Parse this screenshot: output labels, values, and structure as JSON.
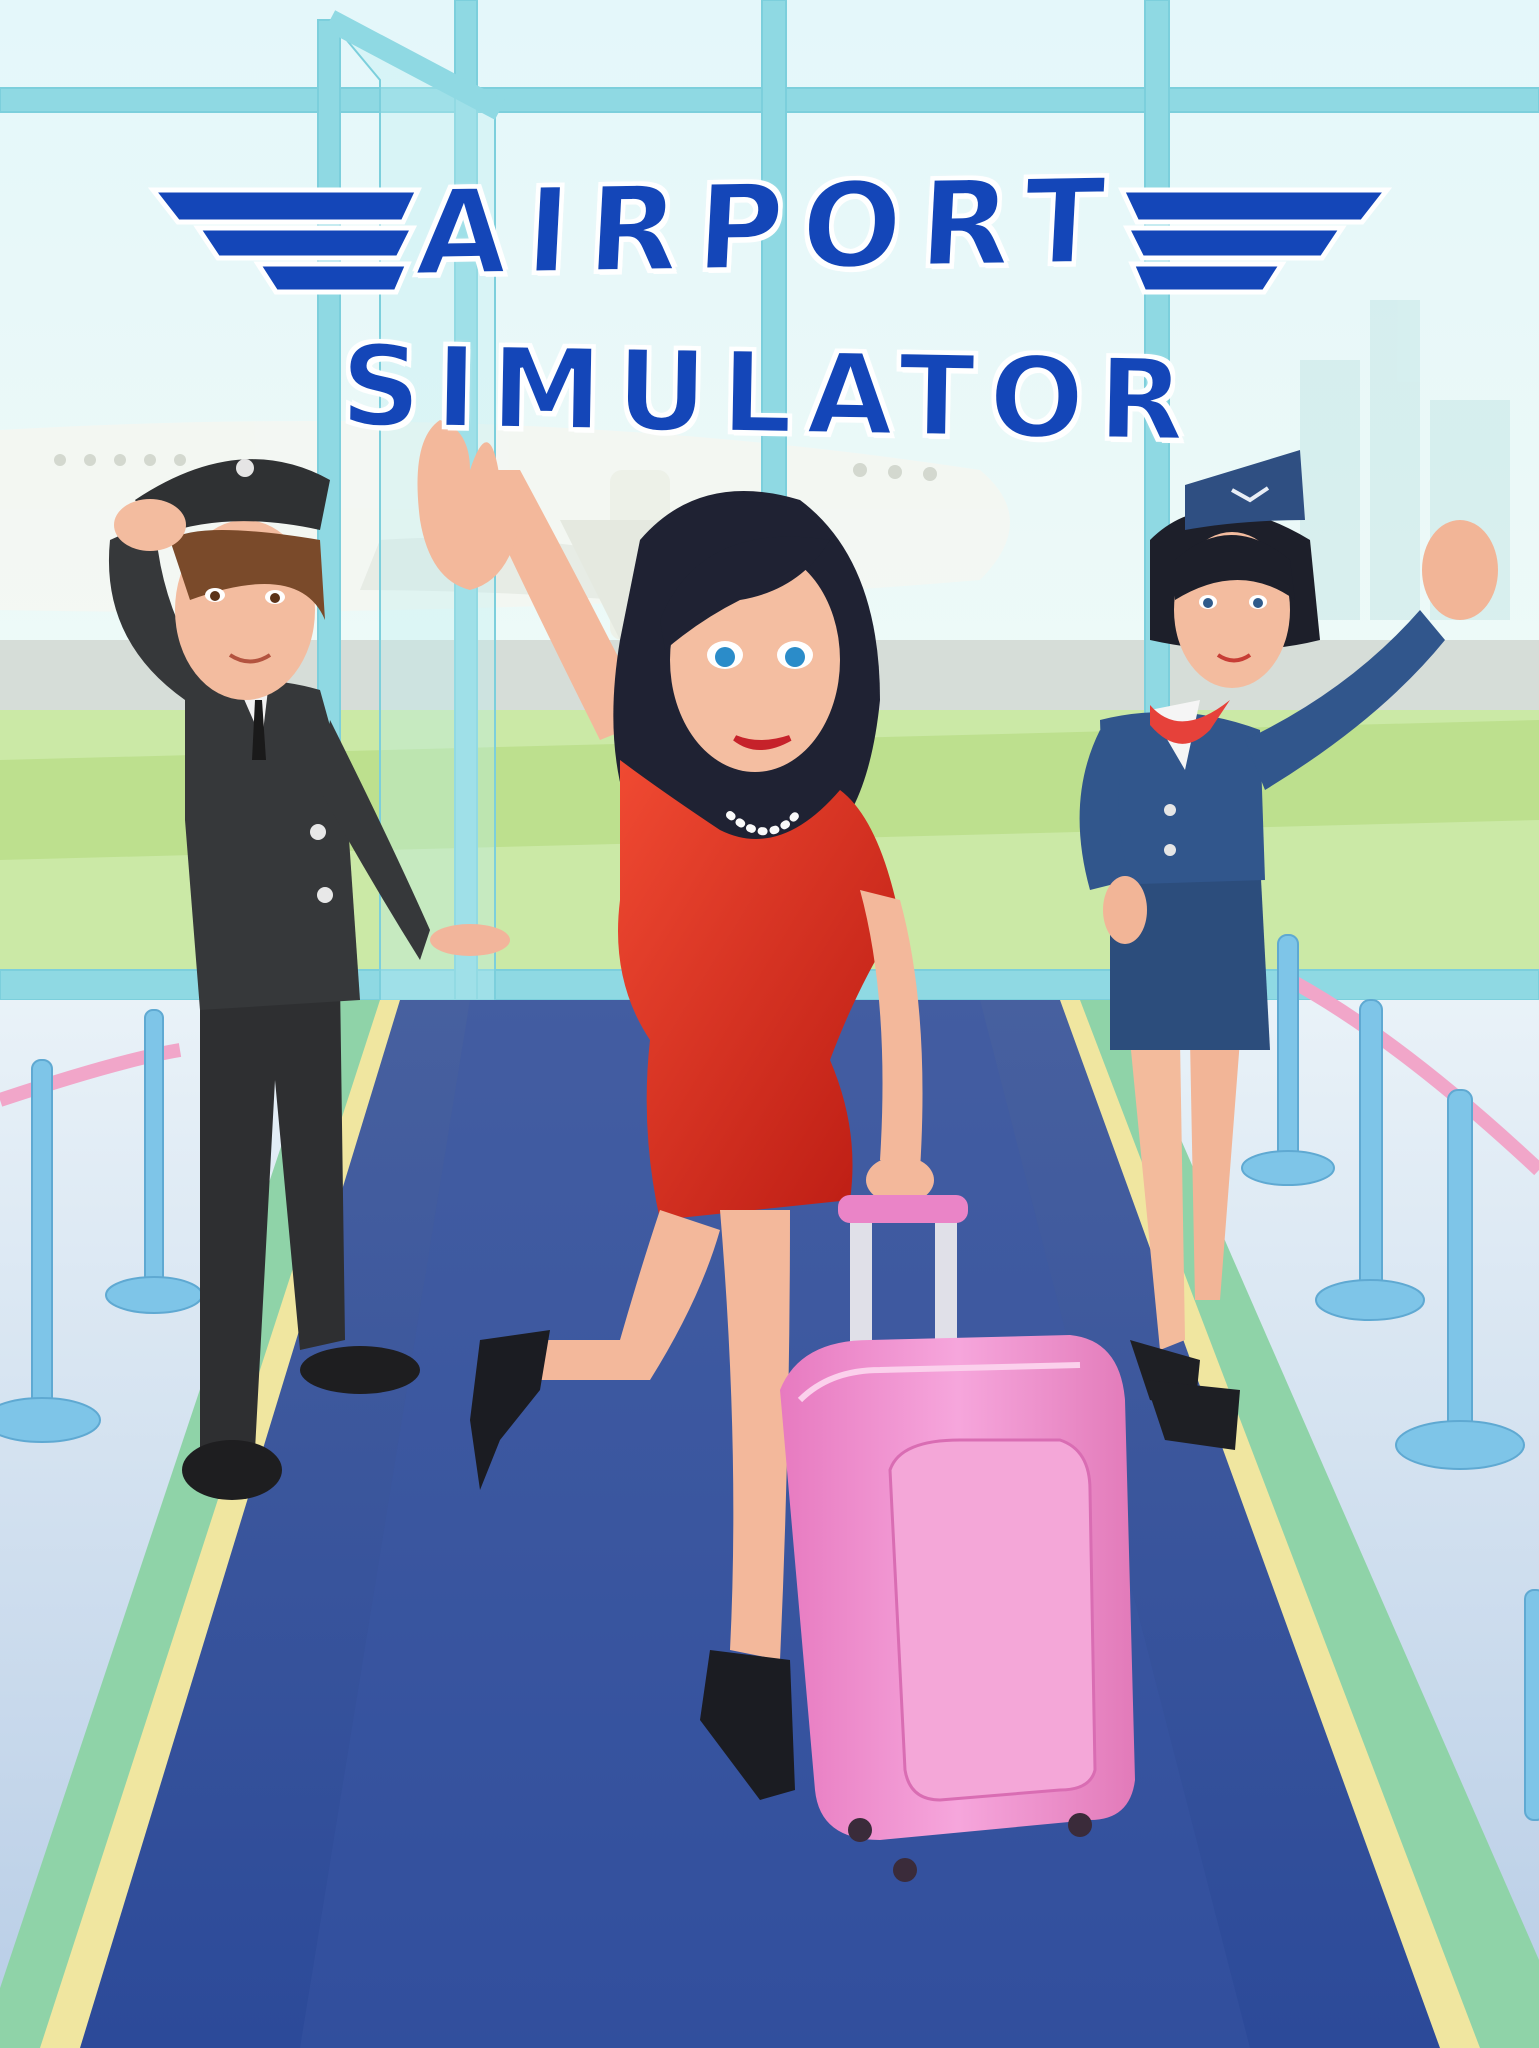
{
  "logo": {
    "line1": "AIRPORT",
    "line2": "SIMULATOR",
    "color": "#1446b8",
    "outline_color": "#ffffff",
    "icon": "wings-icon"
  },
  "characters": [
    {
      "role": "pilot",
      "icon": "pilot-character"
    },
    {
      "role": "passenger",
      "icon": "passenger-character"
    },
    {
      "role": "flight-attendant",
      "icon": "flight-attendant-character"
    }
  ],
  "props": {
    "suitcase_color": "#ef8fce",
    "carpet_color": "#2f4f9a",
    "dress_color": "#d8281c"
  }
}
